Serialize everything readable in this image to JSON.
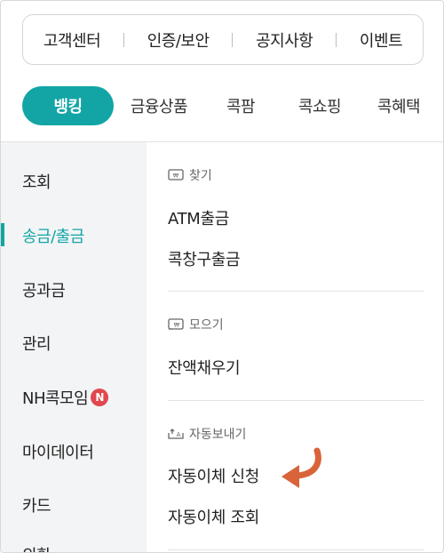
{
  "quick_links": [
    "고객센터",
    "인증/보안",
    "공지사항",
    "이벤트"
  ],
  "tabs": [
    "뱅킹",
    "금융상품",
    "콕팜",
    "콕쇼핑",
    "콕혜택"
  ],
  "sidebar": {
    "items": [
      "조회",
      "송금/출금",
      "공과금",
      "관리",
      "NH콕모임",
      "마이데이터",
      "카드",
      "외환"
    ],
    "active_index": 1,
    "badge": "N"
  },
  "sections": [
    {
      "title": "찾기",
      "icon": "withdraw-icon",
      "items": [
        "ATM출금",
        "콕창구출금"
      ]
    },
    {
      "title": "모으기",
      "icon": "save-icon",
      "items": [
        "잔액채우기"
      ]
    },
    {
      "title": "자동보내기",
      "icon": "auto-transfer-icon",
      "items": [
        "자동이체 신청",
        "자동이체 조회"
      ]
    }
  ],
  "colors": {
    "accent": "#13a5a5",
    "badge": "#e0484e",
    "arrow": "#d9643a",
    "sidebar_bg": "#f3f4f6"
  }
}
